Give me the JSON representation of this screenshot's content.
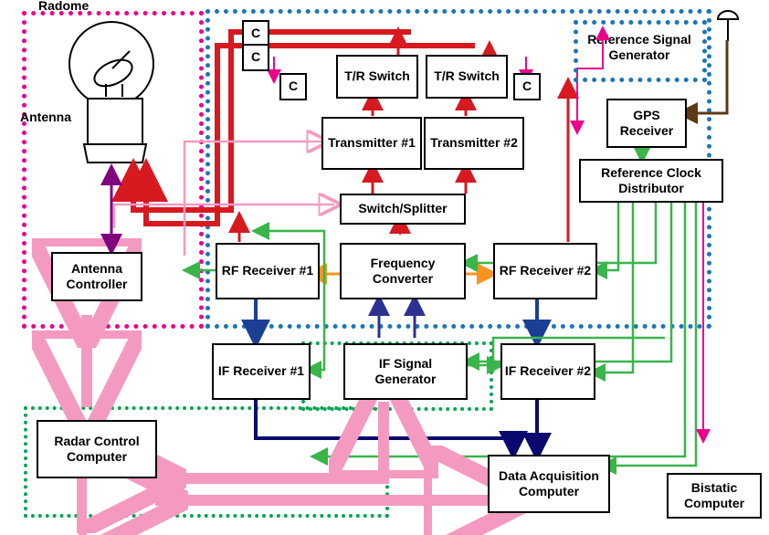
{
  "labels": {
    "radome": "Radome",
    "antenna": "Antenna",
    "ref_sig_gen": "Reference Signal Generator"
  },
  "blocks": {
    "c1": "C",
    "c2": "C",
    "c3": "C",
    "c4": "C",
    "tr_switch_1": "T/R Switch",
    "tr_switch_2": "T/R Switch",
    "transmitter_1": "Transmitter #1",
    "transmitter_2": "Transmitter #2",
    "switch_splitter": "Switch/Splitter",
    "rf_receiver_1": "RF Receiver #1",
    "frequency_converter": "Frequency Converter",
    "rf_receiver_2": "RF Receiver #2",
    "if_receiver_1": "IF Receiver #1",
    "if_signal_generator": "IF Signal Generator",
    "if_receiver_2": "IF Receiver #2",
    "antenna_controller": "Antenna Controller",
    "gps_receiver": "GPS Receiver",
    "ref_clock_distributor": "Reference Clock Distributor",
    "radar_control_computer": "Radar Control Computer",
    "data_acquisition_computer": "Data Acquisition Computer",
    "bistatic_computer": "Bistatic Computer"
  }
}
